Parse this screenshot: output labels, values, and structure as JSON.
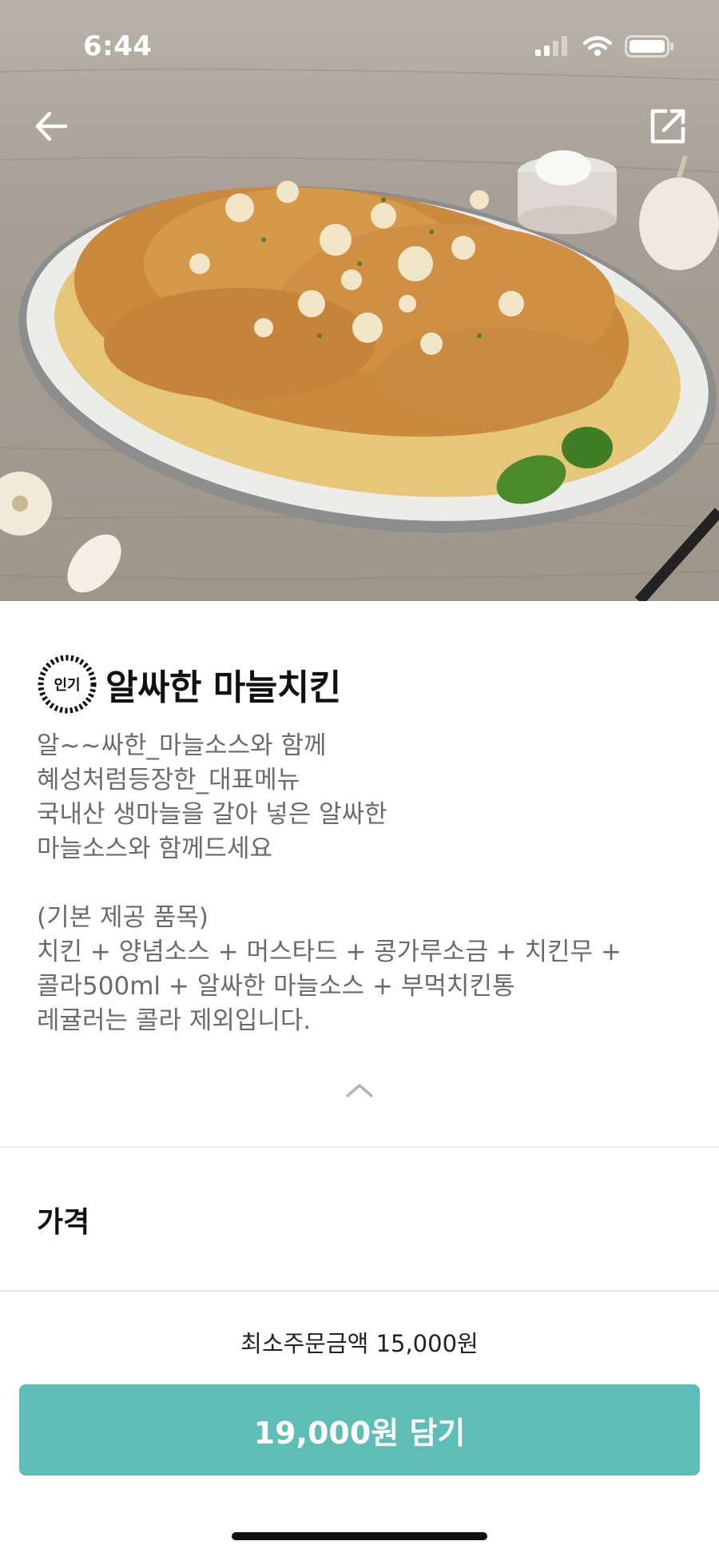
{
  "status_bar": {
    "time": "6:44"
  },
  "nav": {
    "back_icon": "arrow-left-icon",
    "share_icon": "share-external-icon"
  },
  "hero": {
    "image_alt": "garlic-chicken-photo"
  },
  "item": {
    "badge": "인기",
    "title": "알싸한 마늘치킨",
    "description_lines": [
      "알~~싸한_마늘소스와 함께",
      "혜성처럼등장한_대표메뉴",
      "국내산 생마늘을 갈아 넣은 알싸한",
      "마늘소스와 함께드세요",
      "",
      "(기본 제공 품목)",
      "치킨 + 양념소스 + 머스타드 + 콩가루소금 + 치킨무 +",
      "콜라500ml + 알싸한 마늘소스 + 부먹치킨통",
      "레귤러는 콜라 제외입니다."
    ]
  },
  "price_section": {
    "heading": "가격"
  },
  "footer": {
    "min_order": "최소주문금액 15,000원",
    "cart_button": "19,000원 담기"
  },
  "colors": {
    "accent": "#5fbdb8",
    "description_text": "#6b6b6b"
  }
}
